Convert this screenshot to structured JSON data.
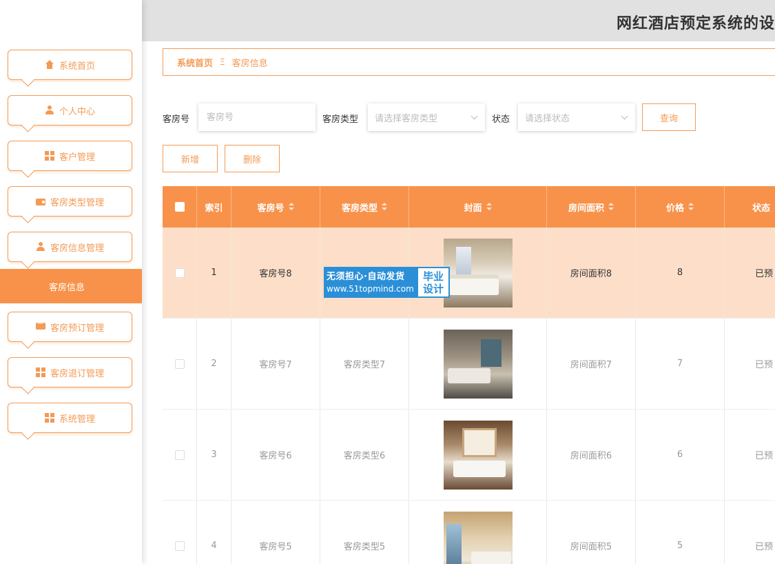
{
  "app": {
    "title": "网红酒店预定系统的设"
  },
  "sidebar": {
    "items": [
      {
        "label": "系统首页",
        "icon": "home-icon"
      },
      {
        "label": "个人中心",
        "icon": "user-icon"
      },
      {
        "label": "客户管理",
        "icon": "grid-icon"
      },
      {
        "label": "客房类型管理",
        "icon": "wallet-icon"
      },
      {
        "label": "客房信息管理",
        "icon": "user-icon"
      },
      {
        "label": "客房预订管理",
        "icon": "chat-icon"
      },
      {
        "label": "客房退订管理",
        "icon": "grid-icon"
      },
      {
        "label": "系统管理",
        "icon": "grid-icon"
      }
    ],
    "active_sub": "客房信息"
  },
  "breadcrumb": {
    "home": "系统首页",
    "separator": "Ξ",
    "current": "客房信息"
  },
  "filters": {
    "room_no_label": "客房号",
    "room_no_placeholder": "客房号",
    "room_type_label": "客房类型",
    "room_type_placeholder": "请选择客房类型",
    "status_label": "状态",
    "status_placeholder": "请选择状态",
    "query_button": "查询"
  },
  "actions": {
    "add": "新增",
    "delete": "删除"
  },
  "table": {
    "headers": {
      "index": "索引",
      "room_no": "客房号",
      "room_type": "客房类型",
      "cover": "封面",
      "area": "房间面积",
      "price": "价格",
      "status": "状态"
    },
    "rows": [
      {
        "index": "1",
        "room_no": "客房号8",
        "room_type": "",
        "area": "房间面积8",
        "price": "8",
        "status": "已预"
      },
      {
        "index": "2",
        "room_no": "客房号7",
        "room_type": "客房类型7",
        "area": "房间面积7",
        "price": "7",
        "status": "已预"
      },
      {
        "index": "3",
        "room_no": "客房号6",
        "room_type": "客房类型6",
        "area": "房间面积6",
        "price": "6",
        "status": "已预"
      },
      {
        "index": "4",
        "room_no": "客房号5",
        "room_type": "客房类型5",
        "area": "房间面积5",
        "price": "5",
        "status": "已预"
      }
    ]
  },
  "watermark": {
    "line1": "无须担心·自动发货",
    "line2": "www.51topmind.com",
    "badge_top": "毕业",
    "badge_bottom": "设计"
  },
  "colors": {
    "accent": "#f8924a",
    "border": "#f39a55",
    "highlight_row": "#fddfc9",
    "header_bg": "#e1e1e1",
    "watermark_blue": "#2b8fd8"
  }
}
